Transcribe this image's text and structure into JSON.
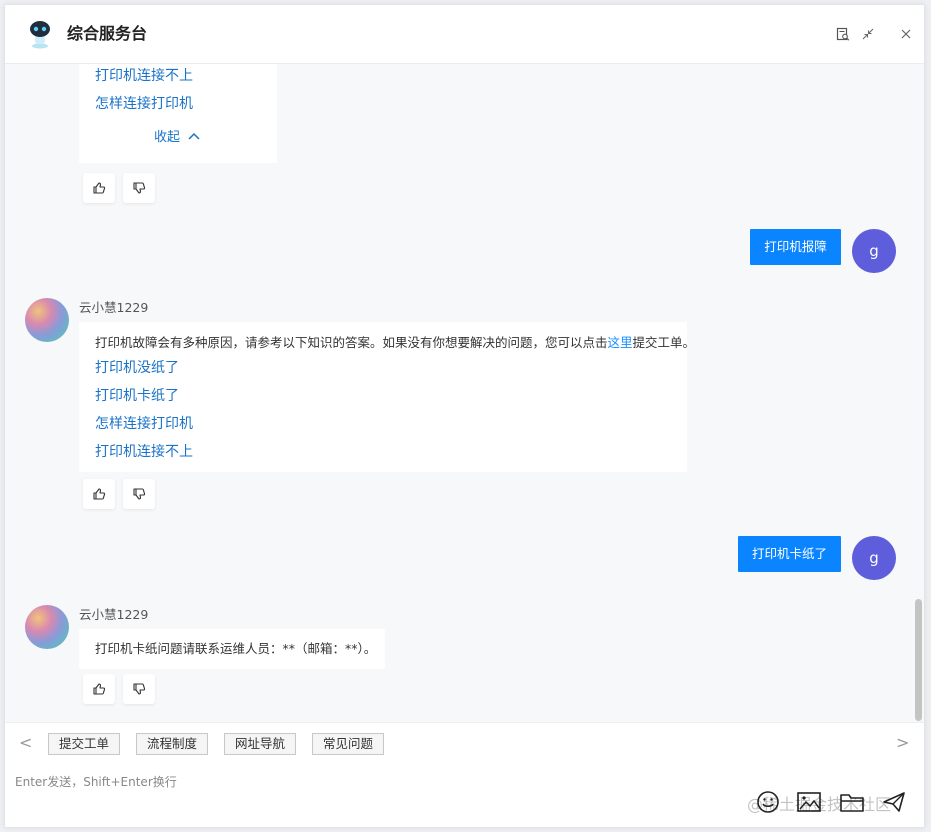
{
  "app": {
    "title": "综合服务台"
  },
  "chat": {
    "card_top": {
      "links": [
        "打印机连接不上",
        "怎样连接打印机"
      ],
      "collapse_label": "收起"
    },
    "user_msg_1": {
      "text": "打印机报障",
      "avatar": "g"
    },
    "bot_msg_1": {
      "name": "云小慧1229",
      "intro_before": "打印机故障会有多种原因，请参考以下知识的答案。如果没有你想要解决的问题，您可以点击",
      "intro_link": "这里",
      "intro_after": "提交工单。",
      "links": [
        "打印机没纸了",
        "打印机卡纸了",
        "怎样连接打印机",
        "打印机连接不上"
      ]
    },
    "user_msg_2": {
      "text": "打印机卡纸了",
      "avatar": "g"
    },
    "bot_msg_2": {
      "name": "云小慧1229",
      "text": "打印机卡纸问题请联系运维人员：**（邮箱：**）。"
    }
  },
  "quickbar": {
    "prev": "<",
    "next": ">",
    "buttons": [
      "提交工单",
      "流程制度",
      "网址导航",
      "常见问题"
    ]
  },
  "input": {
    "placeholder": "Enter发送，Shift+Enter换行"
  },
  "watermark": "@稀土掘金技术社区",
  "colors": {
    "accent": "#0a84ff",
    "link": "#1a73c8",
    "user_avatar": "#5e5ddb"
  }
}
